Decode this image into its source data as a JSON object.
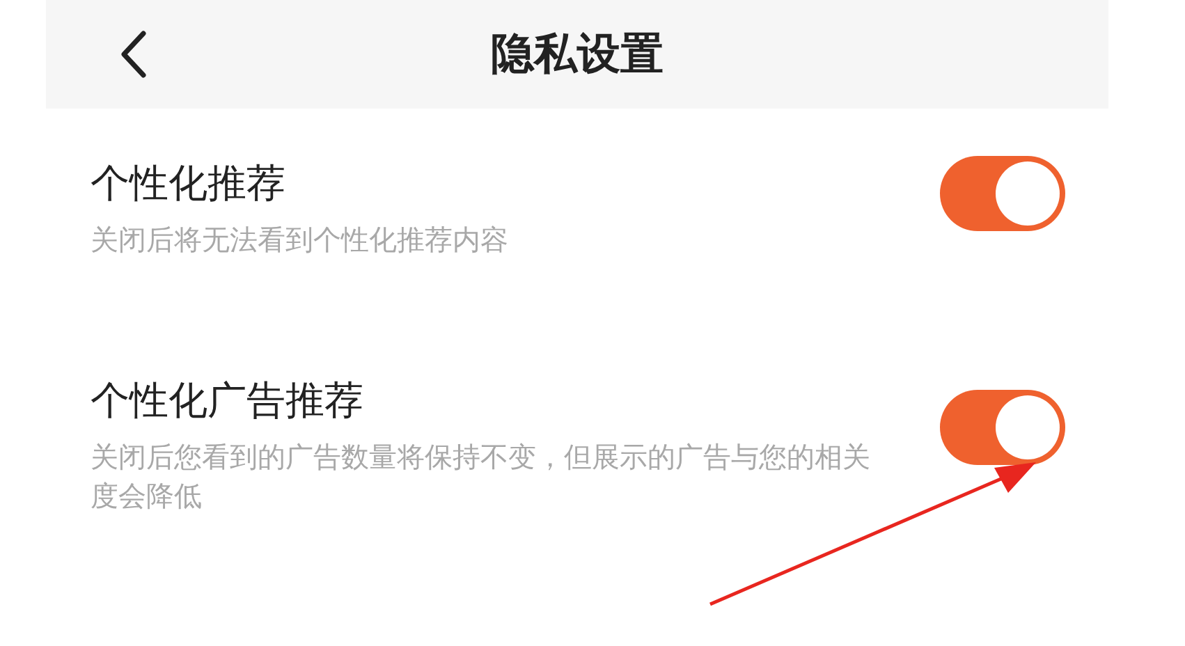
{
  "header": {
    "title": "隐私设置"
  },
  "settings": [
    {
      "title": "个性化推荐",
      "description": "关闭后将无法看到个性化推荐内容",
      "on": true
    },
    {
      "title": "个性化广告推荐",
      "description": "关闭后您看到的广告数量将保持不变，但展示的广告与您的相关度会降低",
      "on": true
    }
  ]
}
